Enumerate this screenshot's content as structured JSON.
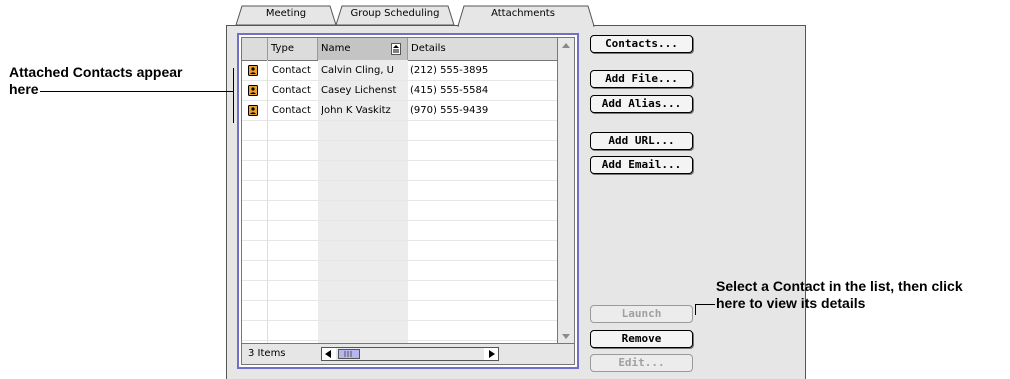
{
  "tabs": [
    {
      "label": "Meeting"
    },
    {
      "label": "Group Scheduling"
    },
    {
      "label": "Attachments",
      "active": true
    }
  ],
  "list": {
    "columns": [
      "Type",
      "Name",
      "Details"
    ],
    "sorted_column": "Name",
    "rows": [
      {
        "type": "Contact",
        "name": "Calvin Cling, U",
        "details": "(212) 555-3895"
      },
      {
        "type": "Contact",
        "name": "Casey Lichenst",
        "details": "(415) 555-5584"
      },
      {
        "type": "Contact",
        "name": "John K Vaskitz",
        "details": "(970) 555-9439"
      }
    ],
    "items_count": "3 Items"
  },
  "buttons": {
    "contacts": "Contacts...",
    "add_file": "Add File...",
    "add_alias": "Add Alias...",
    "add_url": "Add URL...",
    "add_email": "Add Email...",
    "launch": "Launch",
    "remove": "Remove",
    "edit": "Edit..."
  },
  "annotations": {
    "left_line1": "Attached Contacts appear",
    "left_line2": "here",
    "right_line1": "Select a Contact in the list, then click",
    "right_line2": "here to view its details"
  },
  "colors": {
    "list_focus_border": "#7070c8",
    "scroll_thumb": "#b7b7f0",
    "contact_icon": "#e8a030"
  },
  "icons": {
    "contact_row": "contact-card-icon",
    "sort": "sort-direction-icon"
  }
}
